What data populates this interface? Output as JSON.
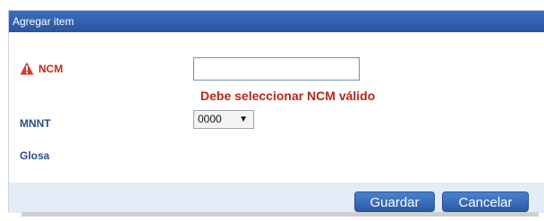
{
  "dialog": {
    "title": "Agregar item",
    "fields": {
      "ncm": {
        "label": "NCM",
        "value": "",
        "error": "Debe seleccionar NCM válido"
      },
      "mnnt": {
        "label": "MNNT",
        "selected": "0000"
      },
      "glosa": {
        "label": "Glosa"
      }
    },
    "buttons": {
      "save": "Guardar",
      "cancel": "Cancelar"
    }
  },
  "icons": {
    "ncm_warning": "warning-triangle-icon",
    "select_arrow": "chevron-down-icon"
  },
  "colors": {
    "title_bar": "#2e5da8",
    "error": "#b5261a",
    "button": "#2f64b4",
    "footer": "#e4ecf7"
  }
}
